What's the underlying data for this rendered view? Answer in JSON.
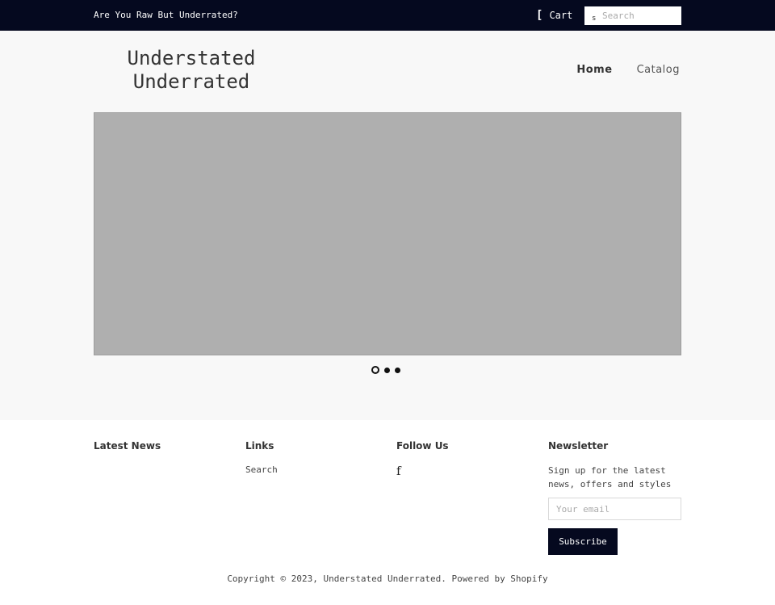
{
  "topbar": {
    "announcement": "Are You Raw But Underrated?",
    "cart_icon": "[",
    "cart_label": "Cart",
    "search_icon": "s",
    "search_placeholder": "Search",
    "background_color": "#05091f"
  },
  "header": {
    "logo_line1": "Understated",
    "logo_line2": "Underrated",
    "nav": [
      {
        "label": "Home",
        "active": true
      },
      {
        "label": "Catalog",
        "active": false
      }
    ]
  },
  "slideshow": {
    "slide_count": 3,
    "active_index": 0
  },
  "footer": {
    "latest_news_title": "Latest News",
    "links_title": "Links",
    "links": [
      {
        "label": "Search"
      }
    ],
    "follow_title": "Follow Us",
    "follow_icon": "f",
    "newsletter_title": "Newsletter",
    "newsletter_text": "Sign up for the latest news, offers and styles",
    "email_placeholder": "Your email",
    "subscribe_label": "Subscribe",
    "copyright": "Copyright © 2023, Understated Underrated. Powered by Shopify"
  },
  "icons": {
    "cart": "cart-icon",
    "search": "search-icon",
    "facebook": "facebook-icon"
  }
}
